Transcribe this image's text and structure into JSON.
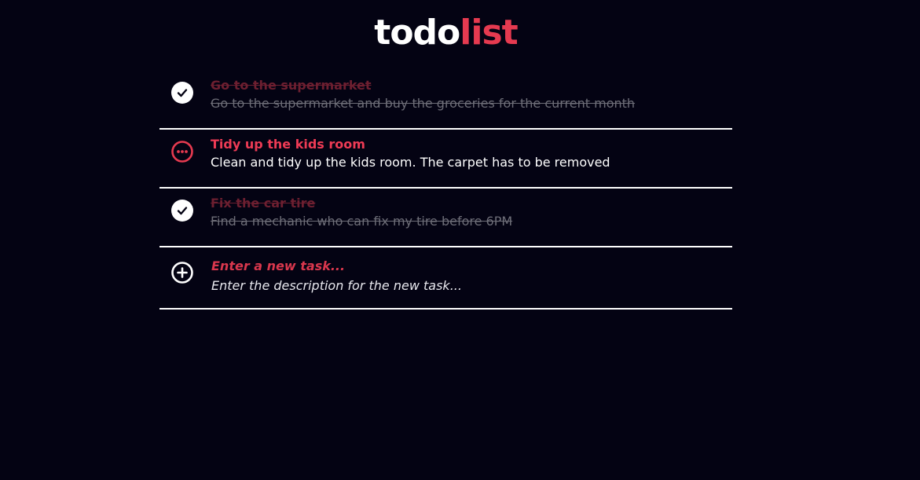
{
  "header": {
    "title_part1": "todo",
    "title_part2": "list"
  },
  "colors": {
    "background": "#040313",
    "accent": "#e63a50",
    "done_title": "#6d1f30",
    "done_description": "#6e6e78",
    "text": "#ffffff"
  },
  "tasks": [
    {
      "title": "Go to the supermarket",
      "description": "Go to the supermarket and buy the groceries for the current month",
      "status": "done",
      "icon": "check-circle-icon"
    },
    {
      "title": "Tidy up the kids room",
      "description": "Clean and tidy up the kids room. The carpet has to be removed",
      "status": "pending",
      "icon": "more-circle-icon"
    },
    {
      "title": "Fix the car tire",
      "description": "Find a mechanic who can fix my tire before 6PM",
      "status": "done",
      "icon": "check-circle-icon"
    }
  ],
  "new_task": {
    "icon": "plus-circle-icon",
    "title_placeholder": "Enter a new task...",
    "description_placeholder": "Enter the description for the new task..."
  }
}
